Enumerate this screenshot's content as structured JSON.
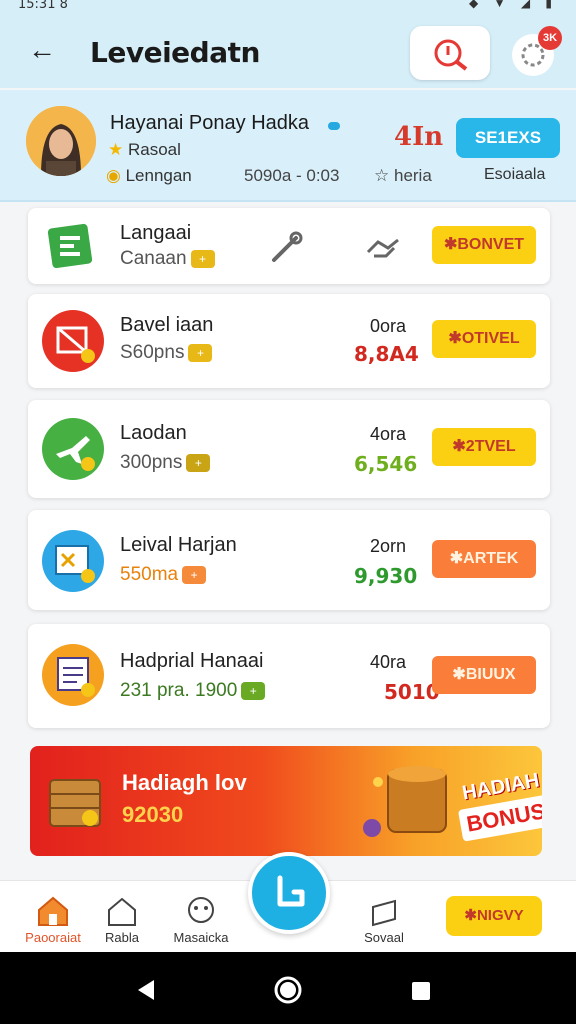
{
  "status": {
    "time": "15:31 8",
    "icons": "signal wifi battery"
  },
  "appbar": {
    "title": "Leveiedatn",
    "badge": "3K"
  },
  "profile": {
    "name": "Hayanai Ponay Hadka",
    "rank": "Rasoal",
    "level": "Lenngan",
    "score": "5090a - 0:03",
    "value": "4In",
    "star_label": "heria",
    "button": "SE1EXS",
    "extra": "Esoiaala"
  },
  "rows": [
    {
      "name": "Langaai",
      "sub": "Canaan",
      "unit": "",
      "value": "",
      "button": "✱BONVET",
      "btn_style": "y",
      "icon_color": "#fff",
      "value_color": "#c62828"
    },
    {
      "name": "Bavel iaan",
      "sub": "S60pns",
      "unit": "0ora",
      "value": "8,8A4",
      "button": "✱OTIVEL",
      "btn_style": "y",
      "icon_color": "#e53224",
      "value_color": "#d1281f"
    },
    {
      "name": "Laodan",
      "sub": "300pns",
      "unit": "4ora",
      "value": "6,546",
      "button": "✱2TVEL",
      "btn_style": "y",
      "icon_color": "#46b043",
      "value_color": "#6fae1d"
    },
    {
      "name": "Leival Harjan",
      "sub": "550ma",
      "unit": "2orn",
      "value": "9,930",
      "button": "✱ARTEK",
      "btn_style": "o",
      "icon_color": "#2ea7e6",
      "value_color": "#2e9a2e"
    },
    {
      "name": "Hadprial Hanaai",
      "sub": "231 pra. 1900",
      "unit": "40ra",
      "value": "5010",
      "button": "✱BIUUX",
      "btn_style": "o",
      "icon_color": "#f5a01e",
      "value_color": "#d1281f"
    }
  ],
  "banner": {
    "title": "Hadiagh lov",
    "number": "92030",
    "bonus_top": "HADIAH",
    "bonus_bottom": "BONUS"
  },
  "nav": {
    "items": [
      "Paooraiat",
      "Rabla",
      "Masaicka",
      "Sovaal"
    ],
    "button": "✱NIGVY"
  }
}
